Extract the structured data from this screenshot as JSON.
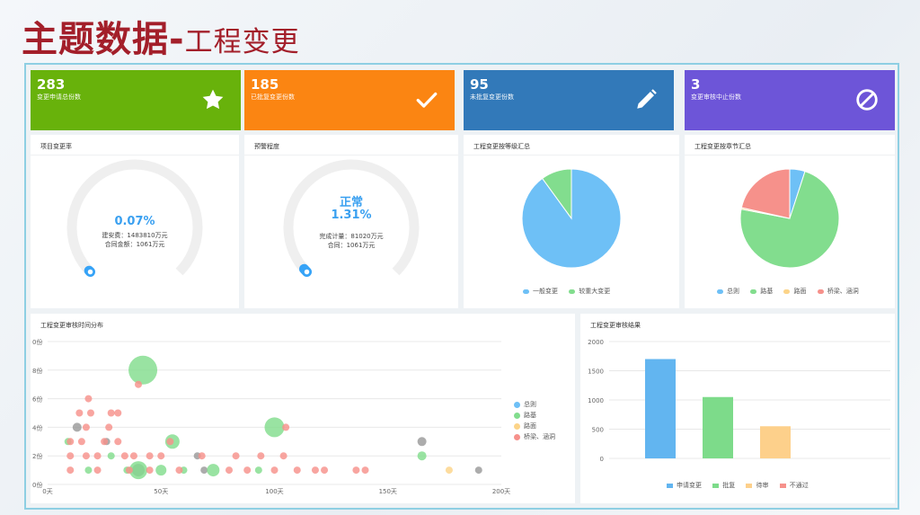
{
  "page": {
    "title_main": "主题数据-",
    "title_sub": "工程变更"
  },
  "colors": {
    "green": "#68b20b",
    "orange": "#fb8512",
    "blue": "#3279b9",
    "purple": "#6d55d8",
    "pie_blue": "#6ec0f6",
    "pie_green": "#82dd8e",
    "pie_yellow": "#fcd489",
    "pie_red": "#f6918b",
    "gauge_blue": "#36a3f7",
    "gauge_track": "#efefef"
  },
  "kpis": [
    {
      "value": "283",
      "label": "变更申请总份数",
      "icon": "star-icon",
      "color": "#68b20b"
    },
    {
      "value": "185",
      "label": "已批复变更份数",
      "icon": "check-icon",
      "color": "#fb8512"
    },
    {
      "value": "95",
      "label": "未批复变更份数",
      "icon": "pencil-icon",
      "color": "#3279b9"
    },
    {
      "value": "3",
      "label": "变更审核中止份数",
      "icon": "ban-icon",
      "color": "#6d55d8"
    }
  ],
  "gauges": [
    {
      "title": "项目变更率",
      "status": "",
      "percent": "0.07%",
      "line1": "建安费：1483810万元",
      "line2": "合同金额：1061万元",
      "fraction": 0.0007
    },
    {
      "title": "预警程度",
      "status": "正常",
      "percent": "1.31%",
      "line1": "完成计量：81020万元",
      "line2": "合同：1061万元",
      "fraction": 0.0131
    }
  ],
  "pies": [
    {
      "title": "工程变更按等级汇总",
      "legend": [
        "一般变更",
        "较重大变更"
      ],
      "colors": [
        "#6ec0f6",
        "#82dd8e"
      ],
      "values": [
        90,
        10
      ]
    },
    {
      "title": "工程变更按章节汇总",
      "legend": [
        "总则",
        "路基",
        "路面",
        "桥梁、涵洞"
      ],
      "colors": [
        "#6ec0f6",
        "#82dd8e",
        "#fcd489",
        "#f6918b"
      ],
      "values": [
        5,
        73,
        0.5,
        21.5
      ]
    }
  ],
  "scatter_panel": {
    "title": "工程变更审核时间分布"
  },
  "bar_panel": {
    "title": "工程变更审核结果"
  },
  "chart_data": [
    {
      "type": "scatter",
      "title": "工程变更审核时间分布",
      "x_ticks": [
        "0天",
        "50天",
        "100天",
        "150天",
        "200天"
      ],
      "y_ticks": [
        "0份",
        "2份",
        "4份",
        "6份",
        "8份",
        "0份"
      ],
      "xlim": [
        0,
        200
      ],
      "ylim": [
        0,
        10
      ],
      "legend_position": "right",
      "series": [
        {
          "name": "总则",
          "color": "#9a9a9a",
          "points": [
            [
              13,
              4,
              5
            ],
            [
              26,
              3,
              4
            ],
            [
              40,
              1,
              7
            ],
            [
              66,
              2,
              4
            ],
            [
              69,
              1,
              4
            ],
            [
              165,
              3,
              5
            ],
            [
              190,
              1,
              4
            ]
          ]
        },
        {
          "name": "路基",
          "color": "#82dd8e",
          "points": [
            [
              42,
              8,
              16
            ],
            [
              100,
              4,
              11
            ],
            [
              55,
              3,
              8
            ],
            [
              40,
              1,
              10
            ],
            [
              50,
              1,
              6
            ],
            [
              73,
              1,
              7
            ],
            [
              9,
              3,
              4
            ],
            [
              165,
              2,
              5
            ],
            [
              18,
              1,
              4
            ],
            [
              35,
              1,
              4
            ],
            [
              60,
              1,
              4
            ],
            [
              93,
              1,
              4
            ],
            [
              28,
              2,
              4
            ]
          ]
        },
        {
          "name": "路面",
          "color": "#fcd489",
          "points": [
            [
              177,
              1,
              4
            ]
          ]
        },
        {
          "name": "桥梁、涵洞",
          "color": "#f6918b",
          "points": [
            [
              18,
              6,
              4
            ],
            [
              14,
              5,
              4
            ],
            [
              28,
              5,
              4
            ],
            [
              31,
              5,
              4
            ],
            [
              19,
              5,
              4
            ],
            [
              27,
              4,
              4
            ],
            [
              17,
              4,
              4
            ],
            [
              40,
              7,
              4
            ],
            [
              10,
              3,
              4
            ],
            [
              15,
              3,
              4
            ],
            [
              25,
              3,
              4
            ],
            [
              31,
              3,
              4
            ],
            [
              54,
              3,
              4
            ],
            [
              10,
              2,
              4
            ],
            [
              17,
              2,
              4
            ],
            [
              22,
              2,
              4
            ],
            [
              34,
              2,
              4
            ],
            [
              38,
              2,
              4
            ],
            [
              45,
              2,
              4
            ],
            [
              50,
              2,
              4
            ],
            [
              68,
              2,
              4
            ],
            [
              83,
              2,
              4
            ],
            [
              94,
              2,
              4
            ],
            [
              104,
              2,
              4
            ],
            [
              10,
              1,
              4
            ],
            [
              22,
              1,
              4
            ],
            [
              36,
              1,
              4
            ],
            [
              45,
              1,
              4
            ],
            [
              58,
              1,
              4
            ],
            [
              80,
              1,
              4
            ],
            [
              88,
              1,
              4
            ],
            [
              100,
              1,
              4
            ],
            [
              110,
              1,
              4
            ],
            [
              118,
              1,
              4
            ],
            [
              122,
              1,
              4
            ],
            [
              136,
              1,
              4
            ],
            [
              140,
              1,
              4
            ],
            [
              105,
              4,
              4
            ]
          ]
        }
      ]
    },
    {
      "type": "bar",
      "title": "工程变更审核结果",
      "categories": [
        "申请变更",
        "批复",
        "待审",
        "不通过"
      ],
      "values": [
        1700,
        1050,
        550,
        0
      ],
      "colors": [
        "#62b5f0",
        "#7ddb8a",
        "#fdd08b",
        "#f6918b"
      ],
      "y_ticks": [
        "0",
        "500",
        "1000",
        "1500",
        "2000"
      ],
      "ylim": [
        0,
        2000
      ],
      "legend_position": "bottom"
    }
  ]
}
